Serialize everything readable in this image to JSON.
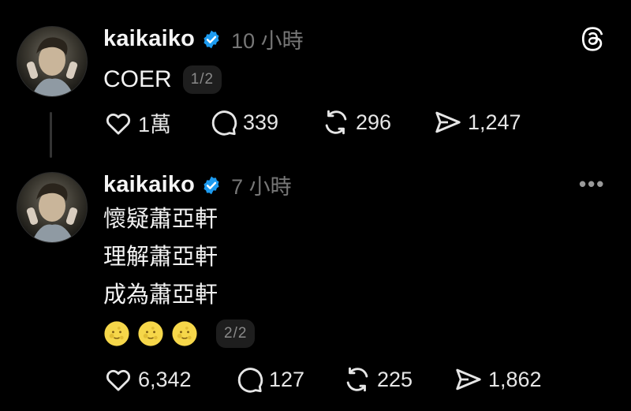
{
  "posts": [
    {
      "username": "kaikaiko",
      "time": "10 小時",
      "lines": [
        "COER"
      ],
      "pager": "1/2",
      "actions": {
        "likes": "1萬",
        "replies": "339",
        "reposts": "296",
        "shares": "1,247"
      }
    },
    {
      "username": "kaikaiko",
      "time": "7 小時",
      "lines": [
        "懷疑蕭亞軒",
        "理解蕭亞軒",
        "成為蕭亞軒"
      ],
      "pager": "2/2",
      "actions": {
        "likes": "6,342",
        "replies": "127",
        "reposts": "225",
        "shares": "1,862"
      }
    }
  ],
  "icons": {
    "verified": "verified-badge-icon",
    "threads_logo": "threads-logo-icon",
    "more": "more-options-icon",
    "like": "heart-icon",
    "reply": "comment-bubble-icon",
    "repost": "repost-icon",
    "share": "send-icon",
    "emoji": "full-moon-face-emoji"
  },
  "colors": {
    "background": "#000000",
    "verified": "#1d9bf0",
    "muted": "#777777"
  }
}
